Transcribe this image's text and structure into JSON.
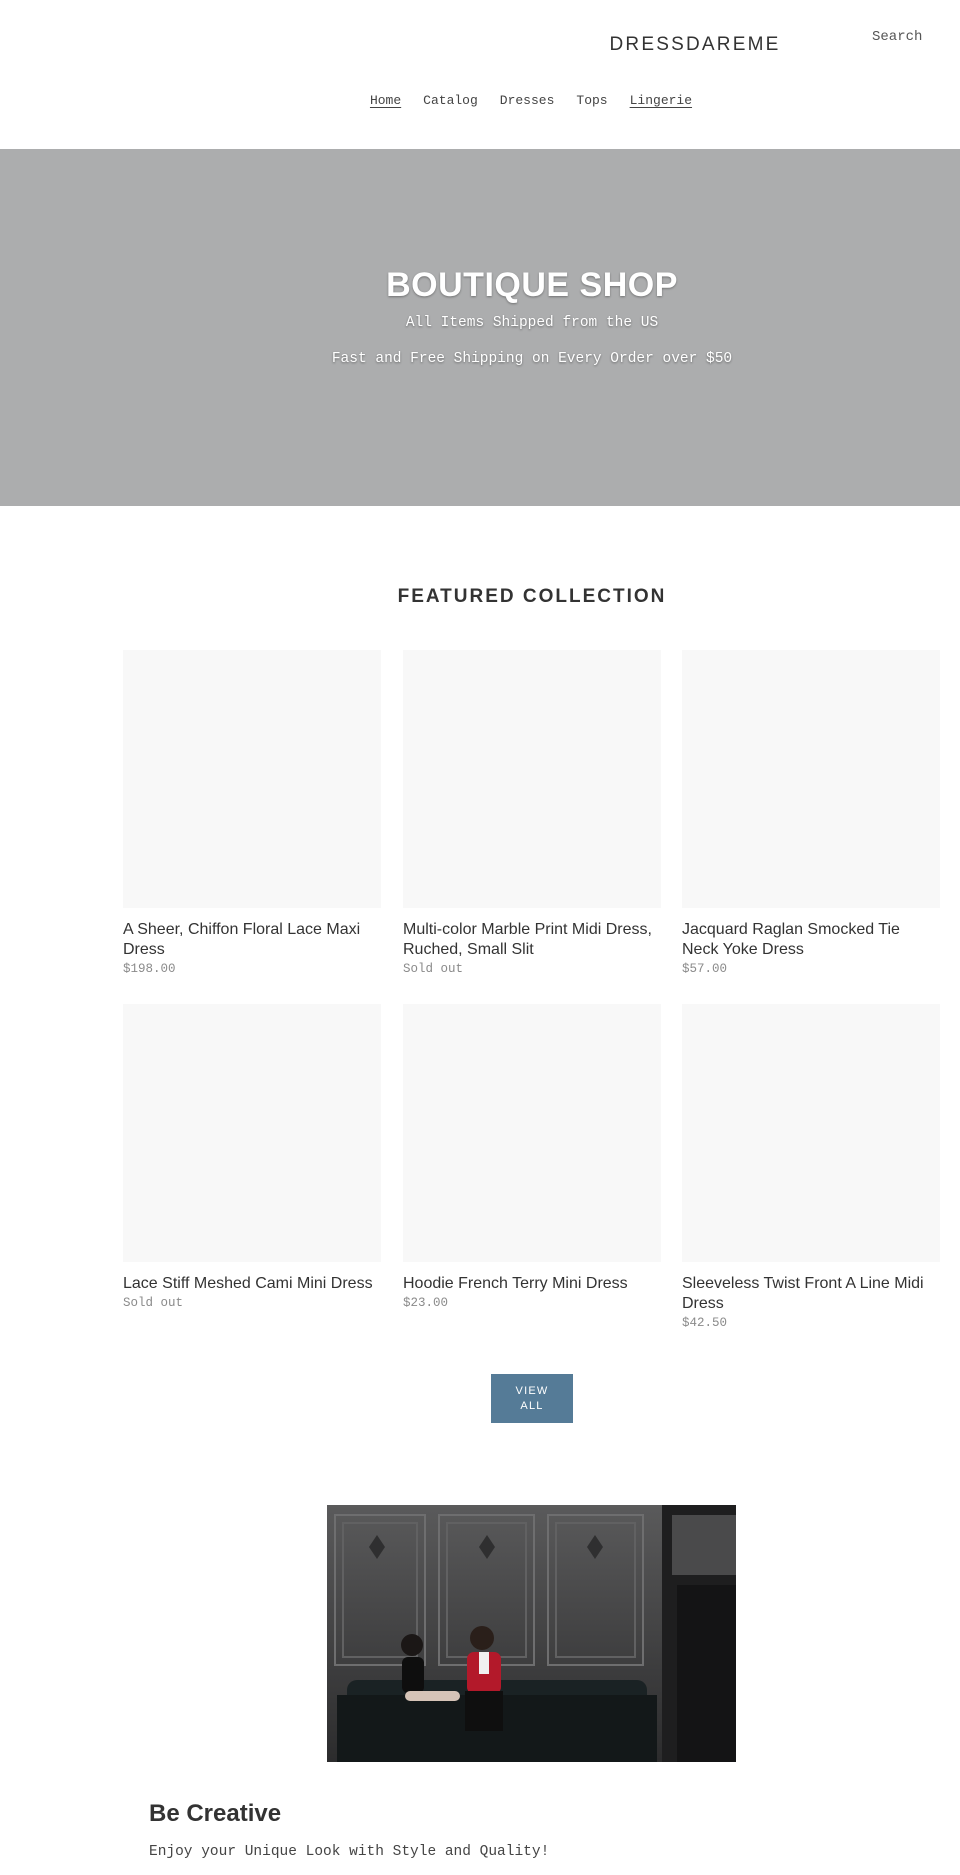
{
  "header": {
    "logo": "DRESSDAREME",
    "search_label": "Search",
    "nav": [
      {
        "label": "Home",
        "active": true
      },
      {
        "label": "Catalog",
        "active": false
      },
      {
        "label": "Dresses",
        "active": false
      },
      {
        "label": "Tops",
        "active": false
      },
      {
        "label": "Lingerie",
        "active": true
      }
    ]
  },
  "hero": {
    "title": "BOUTIQUE SHOP",
    "line1": "All Items Shipped from the US",
    "line2": "Fast and Free Shipping on Every Order over $50",
    "background": "#acadae"
  },
  "featured": {
    "title": "FEATURED COLLECTION",
    "products": [
      {
        "title": "A Sheer, Chiffon Floral Lace Maxi Dress",
        "price": "$198.00"
      },
      {
        "title": "Multi-color Marble Print Midi Dress, Ruched, Small Slit",
        "price": "Sold out"
      },
      {
        "title": "Jacquard Raglan Smocked Tie Neck Yoke Dress",
        "price": "$57.00"
      },
      {
        "title": "Lace Stiff Meshed Cami Mini Dress",
        "price": "Sold out"
      },
      {
        "title": "Hoodie French Terry Mini Dress",
        "price": "$23.00"
      },
      {
        "title": "Sleeveless Twist Front A Line Midi Dress",
        "price": "$42.50"
      }
    ],
    "view_all_label": "VIEW ALL",
    "button_color": "#557b97"
  },
  "feature_image": {
    "icon": "couple-on-sofa-photo"
  },
  "creative": {
    "title": "Be Creative",
    "text": "Enjoy your Unique Look with Style and Quality!"
  }
}
